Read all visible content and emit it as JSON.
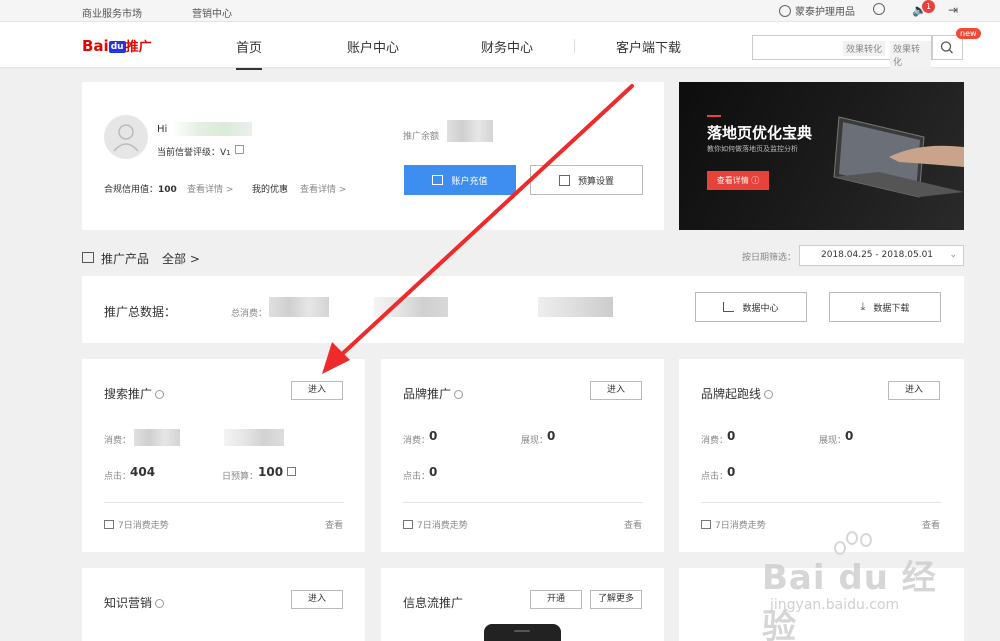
{
  "topbar": {
    "links": [
      "商业服务市场",
      "营销中心"
    ],
    "username": "蒙泰护理用品",
    "notification_count": "1"
  },
  "header": {
    "logo": {
      "bai": "Bai",
      "du": "du",
      "tg": "推广"
    },
    "nav": [
      "首页",
      "账户中心",
      "财务中心",
      "客户端下载"
    ],
    "search_tags": [
      "效果转化",
      "效果转化"
    ],
    "new_badge": "new"
  },
  "account": {
    "greeting": "Hi",
    "credit_level_label": "当前信誉评级：V",
    "credit_level_value": "1",
    "compliance_label": "合规信用值：",
    "compliance_value": "100",
    "view_details": "查看详情 >",
    "my_offers": "我的优惠",
    "balance_label": "推广余额",
    "recharge_btn": "账户充值",
    "budget_btn": "预算设置"
  },
  "banner": {
    "title": "落地页优化宝典",
    "subtitle": "教你如何做落地页及监控分析",
    "cta": "查看详情"
  },
  "products": {
    "label": "推广产品",
    "all": "全部 >",
    "date_filter_label": "按日期筛选：",
    "date_range": "2018.04.25 - 2018.05.01"
  },
  "totals": {
    "label": "推广总数据：",
    "spend_label": "总消费：",
    "data_center_btn": "数据中心",
    "download_btn": "数据下载"
  },
  "cards": {
    "search": {
      "title": "搜索推广",
      "enter": "进入",
      "spend": "消费：",
      "clicks_label": "点击：",
      "clicks": "404",
      "budget_label": "日预算：",
      "budget": "100",
      "trend": "7日消费走势",
      "view": "查看"
    },
    "brand": {
      "title": "品牌推广",
      "enter": "进入",
      "spend": "消费：",
      "spend_val": "0",
      "show": "展现：",
      "show_val": "0",
      "clicks_label": "点击：",
      "clicks": "0",
      "trend": "7日消费走势",
      "view": "查看"
    },
    "brand_start": {
      "title": "品牌起跑线",
      "enter": "进入",
      "spend": "消费：",
      "spend_val": "0",
      "show": "展现：",
      "show_val": "0",
      "clicks_label": "点击：",
      "clicks": "0",
      "trend": "7日消费走势",
      "view": "查看"
    },
    "knowledge": {
      "title": "知识营销",
      "enter": "进入"
    },
    "feed": {
      "title": "信息流推广",
      "open": "开通",
      "learn": "了解更多"
    }
  },
  "watermark": {
    "logo": "Bai du 经验",
    "url": "jingyan.baidu.com"
  }
}
